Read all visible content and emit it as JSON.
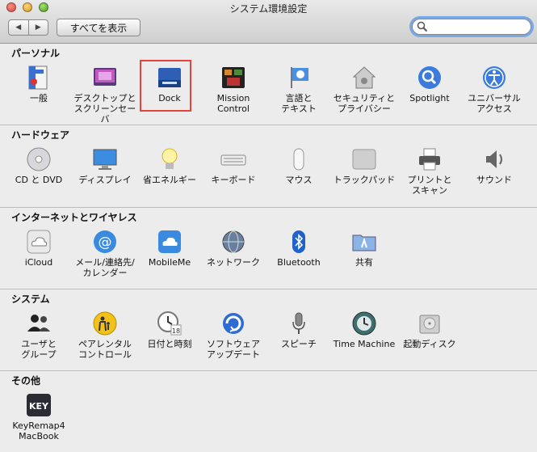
{
  "window": {
    "title": "システム環境設定"
  },
  "toolbar": {
    "back": "◀",
    "forward": "▶",
    "show_all": "すべてを表示",
    "search_placeholder": ""
  },
  "sections": [
    {
      "name": "パーソナル",
      "items": [
        {
          "label": "一般",
          "icon": "general-icon"
        },
        {
          "label": "デスクトップと\nスクリーンセーバ",
          "icon": "desktop-icon"
        },
        {
          "label": "Dock",
          "icon": "dock-icon"
        },
        {
          "label": "Mission\nControl",
          "icon": "mission-control-icon"
        },
        {
          "label": "言語と\nテキスト",
          "icon": "language-icon"
        },
        {
          "label": "セキュリティと\nプライバシー",
          "icon": "security-icon"
        },
        {
          "label": "Spotlight",
          "icon": "spotlight-icon"
        },
        {
          "label": "ユニバーサル\nアクセス",
          "icon": "accessibility-icon"
        }
      ]
    },
    {
      "name": "ハードウェア",
      "items": [
        {
          "label": "CD と DVD",
          "icon": "cd-icon"
        },
        {
          "label": "ディスプレイ",
          "icon": "display-icon"
        },
        {
          "label": "省エネルギー",
          "icon": "energy-icon"
        },
        {
          "label": "キーボード",
          "icon": "keyboard-icon"
        },
        {
          "label": "マウス",
          "icon": "mouse-icon"
        },
        {
          "label": "トラックパッド",
          "icon": "trackpad-icon"
        },
        {
          "label": "プリントと\nスキャン",
          "icon": "printer-icon"
        },
        {
          "label": "サウンド",
          "icon": "sound-icon"
        }
      ]
    },
    {
      "name": "インターネットとワイヤレス",
      "items": [
        {
          "label": "iCloud",
          "icon": "icloud-icon"
        },
        {
          "label": "メール/連絡先/\nカレンダー",
          "icon": "mail-icon"
        },
        {
          "label": "MobileMe",
          "icon": "mobileme-icon"
        },
        {
          "label": "ネットワーク",
          "icon": "network-icon"
        },
        {
          "label": "Bluetooth",
          "icon": "bluetooth-icon"
        },
        {
          "label": "共有",
          "icon": "sharing-icon"
        }
      ]
    },
    {
      "name": "システム",
      "items": [
        {
          "label": "ユーザと\nグループ",
          "icon": "users-icon"
        },
        {
          "label": "ペアレンタル\nコントロール",
          "icon": "parental-icon"
        },
        {
          "label": "日付と時刻",
          "icon": "datetime-icon"
        },
        {
          "label": "ソフトウェア\nアップデート",
          "icon": "update-icon"
        },
        {
          "label": "スピーチ",
          "icon": "speech-icon"
        },
        {
          "label": "Time Machine",
          "icon": "timemachine-icon"
        },
        {
          "label": "起動ディスク",
          "icon": "startup-disk-icon"
        }
      ]
    },
    {
      "name": "その他",
      "items": [
        {
          "label": "KeyRemap4\nMacBook",
          "icon": "keyremap-icon"
        }
      ]
    }
  ],
  "keyremap_badge": "KEY",
  "colors": {
    "highlight": "#e6443a",
    "search_focus": "#78a8e6"
  }
}
